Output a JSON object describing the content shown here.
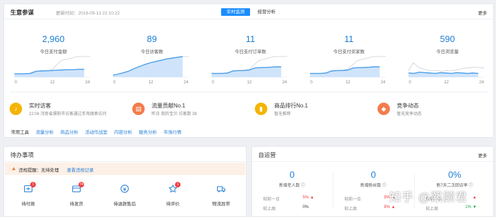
{
  "overview": {
    "title": "生意参谋",
    "update_time": "更新时间：2018-09-13 22:10:22",
    "tab_realtime": "实时监测",
    "tab_business": "经营分析",
    "more": "更多",
    "stats": [
      {
        "value": "2,960",
        "label": "今日支付金额",
        "today": [
          0.16,
          0.16,
          0.17,
          0.18,
          0.28,
          0.3,
          0.31,
          0.32,
          0.34,
          0.35,
          0.36,
          0.36,
          0.38,
          0.38
        ],
        "yesterday": [
          0.16,
          0.16,
          0.17,
          0.18,
          0.26,
          0.3,
          0.31,
          0.32,
          0.36,
          0.62,
          0.82,
          0.86,
          0.92,
          0.98,
          1.0,
          1.0,
          1.0
        ]
      },
      {
        "value": "89",
        "label": "今日访客数",
        "today": [
          0.1,
          0.15,
          0.22,
          0.3,
          0.42,
          0.52,
          0.62,
          0.7,
          0.76,
          0.82,
          0.88,
          0.92,
          0.96,
          1.0
        ],
        "yesterday": [
          0.1,
          0.12,
          0.18,
          0.26,
          0.34,
          0.42,
          0.48,
          0.54,
          0.62,
          0.7,
          0.78,
          0.86,
          0.92,
          0.96,
          0.98,
          1.0,
          1.0
        ]
      },
      {
        "value": "11",
        "label": "今日支付订单数",
        "today": [
          0.18,
          0.18,
          0.18,
          0.2,
          0.3,
          0.32,
          0.32,
          0.34,
          0.44,
          0.46,
          0.47,
          0.48,
          0.5,
          0.5
        ],
        "yesterday": [
          0.18,
          0.18,
          0.18,
          0.19,
          0.26,
          0.3,
          0.32,
          0.34,
          0.4,
          0.6,
          0.8,
          0.86,
          0.92,
          0.98,
          1.0,
          1.0,
          1.0
        ]
      },
      {
        "value": "11",
        "label": "今日支付买家数",
        "today": [
          0.18,
          0.18,
          0.18,
          0.2,
          0.3,
          0.32,
          0.32,
          0.34,
          0.44,
          0.46,
          0.47,
          0.48,
          0.5,
          0.5
        ],
        "yesterday": [
          0.18,
          0.18,
          0.18,
          0.19,
          0.26,
          0.3,
          0.32,
          0.34,
          0.4,
          0.6,
          0.8,
          0.86,
          0.92,
          0.98,
          1.0,
          1.0,
          1.0
        ]
      },
      {
        "value": "590",
        "label": "今日浏览量",
        "today": [
          0.2,
          0.18,
          0.24,
          0.22,
          0.2,
          0.18,
          0.22,
          0.2,
          0.18,
          0.22,
          0.2,
          0.18,
          0.2,
          0.18
        ],
        "yesterday": [
          0.3,
          0.7,
          0.5,
          0.4,
          0.34,
          0.3,
          0.32,
          0.28,
          0.32,
          0.3,
          0.34,
          0.4,
          0.44,
          0.46,
          0.48,
          0.46,
          0.44
        ]
      }
    ],
    "x_ticks": [
      "0",
      "12",
      "24"
    ],
    "alerts": [
      {
        "icon": "bell-icon",
        "color": "#f5b400",
        "title": "实时访客",
        "subtitle": "22:04 河南省濮阳市访客通过手淘搜索访问"
      },
      {
        "icon": "store-icon",
        "color": "#f37c4c",
        "title": "流量贡献No.1",
        "subtitle": "昨日 我的宝贝 访客数 38"
      },
      {
        "icon": "rank-icon",
        "color": "#f5b400",
        "title": "商品排行No.1",
        "subtitle": "暂无推荐"
      },
      {
        "icon": "competition-icon",
        "color": "#f37c4c",
        "title": "竞争动态",
        "subtitle": "暂无竞争动态"
      }
    ],
    "tools_label": "常用工具",
    "tools": [
      "流量分析",
      "商品分析",
      "活动作战室",
      "内容分析",
      "服务分析",
      "市场行情"
    ]
  },
  "todo": {
    "title": "待办事项",
    "warning_text": "违规提醒：无待处理",
    "warning_link": "查看违规记录",
    "items": [
      {
        "label": "待付款",
        "badge": "1",
        "icon": "payment-icon"
      },
      {
        "label": "待发货",
        "badge": "74",
        "icon": "shipping-icon"
      },
      {
        "label": "待退款售后",
        "badge": "",
        "icon": "refund-icon"
      },
      {
        "label": "待评价",
        "badge": "1",
        "icon": "review-icon"
      },
      {
        "label": "物流异常",
        "badge": "",
        "icon": "logistics-icon"
      }
    ]
  },
  "self_ops": {
    "title": "自运营",
    "more": "更多",
    "kpis": [
      {
        "value": "0",
        "label": "新增老人数 ⓘ",
        "rows": [
          {
            "name": "较前一日",
            "value": "5%",
            "dir": "up"
          },
          {
            "name": "较上周",
            "value": "0%",
            "dir": ""
          }
        ]
      },
      {
        "value": "0",
        "label": "新增粉丝数 ⓘ",
        "rows": [
          {
            "name": "较前一日",
            "value": "9%",
            "dir": "up"
          },
          {
            "name": "较上周",
            "value": "8%",
            "dir": "up"
          }
        ]
      },
      {
        "value": "0%",
        "label": "新7天二次回访率 ⓘ",
        "rows": [
          {
            "name": "较前一日",
            "value": "",
            "dir": "up"
          },
          {
            "name": "较上周",
            "value": "1%",
            "dir": "down"
          }
        ]
      }
    ]
  },
  "watermark": "知乎 @熙顾君",
  "colors": {
    "accent": "#1a8cff",
    "value_blue": "#1a7fd6",
    "warning_bg": "#fdf0e6",
    "badge_red": "#f23d3d"
  }
}
